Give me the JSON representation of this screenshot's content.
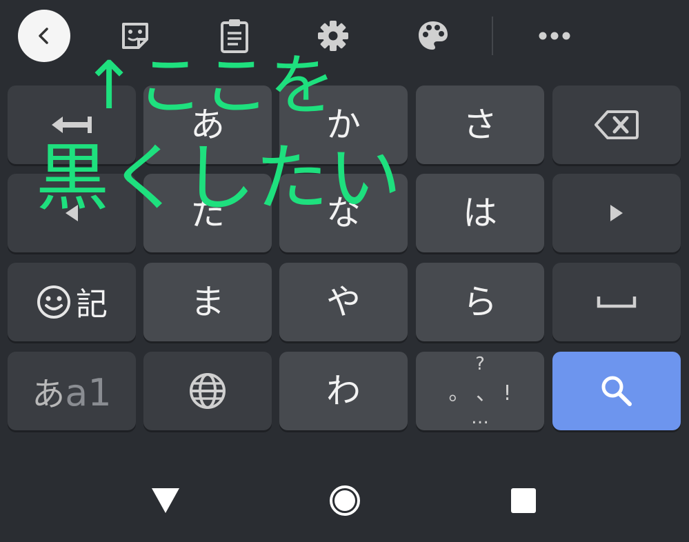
{
  "toolbar": {
    "buttons": [
      {
        "name": "back",
        "icon": "chevron-left-icon"
      },
      {
        "name": "sticker",
        "icon": "sticker-icon"
      },
      {
        "name": "clipboard",
        "icon": "clipboard-icon"
      },
      {
        "name": "settings",
        "icon": "gear-icon"
      },
      {
        "name": "theme",
        "icon": "palette-icon"
      },
      {
        "name": "more",
        "icon": "more-horizontal-icon"
      }
    ]
  },
  "keys": {
    "a": "あ",
    "ka": "か",
    "sa": "さ",
    "ta": "た",
    "na": "な",
    "ha": "は",
    "ma": "ま",
    "ya": "や",
    "ra": "ら",
    "wa": "わ",
    "kigou": "記",
    "mode_kana": "あ",
    "mode_latin": "a1",
    "punct_top": "?",
    "punct_mid": "。 、 !",
    "punct_bottom": "…"
  },
  "icons": {
    "undo": "undo-arrow-icon",
    "backspace": "backspace-icon",
    "cursor_left": "cursor-left-icon",
    "cursor_right": "cursor-right-icon",
    "emoji": "smiley-icon",
    "space": "space-icon",
    "globe": "globe-icon",
    "search": "search-icon"
  },
  "annotation": {
    "line1": "↑ここを",
    "line2": "黒くしたい"
  },
  "navbar": {
    "buttons": [
      {
        "name": "back",
        "icon": "triangle-back-icon"
      },
      {
        "name": "home",
        "icon": "circle-home-icon"
      },
      {
        "name": "recents",
        "icon": "square-recents-icon"
      }
    ]
  },
  "colors": {
    "background": "#2a2d32",
    "key": "#474a4f",
    "function_key": "#3a3d42",
    "search_key": "#6d95ee",
    "annotation": "#1ee07e",
    "icon": "#d0d0d0"
  }
}
